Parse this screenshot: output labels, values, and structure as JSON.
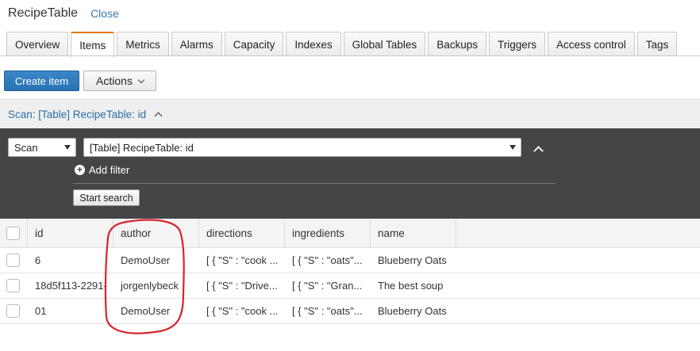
{
  "header": {
    "table_name": "RecipeTable",
    "close_label": "Close"
  },
  "tabs": [
    {
      "label": "Overview",
      "active": false
    },
    {
      "label": "Items",
      "active": true
    },
    {
      "label": "Metrics",
      "active": false
    },
    {
      "label": "Alarms",
      "active": false
    },
    {
      "label": "Capacity",
      "active": false
    },
    {
      "label": "Indexes",
      "active": false
    },
    {
      "label": "Global Tables",
      "active": false
    },
    {
      "label": "Backups",
      "active": false
    },
    {
      "label": "Triggers",
      "active": false
    },
    {
      "label": "Access control",
      "active": false
    },
    {
      "label": "Tags",
      "active": false
    }
  ],
  "toolbar": {
    "create_label": "Create item",
    "actions_label": "Actions"
  },
  "scan_panel": {
    "header_label": "Scan: [Table] RecipeTable: id",
    "mode_value": "Scan",
    "index_value": "[Table] RecipeTable: id",
    "add_filter_label": "Add filter",
    "start_search_label": "Start search"
  },
  "grid": {
    "columns": [
      "id",
      "author",
      "directions",
      "ingredients",
      "name"
    ],
    "rows": [
      {
        "id": "6",
        "author": "DemoUser",
        "directions": "[ { \"S\" : \"cook ...",
        "ingredients": "[ { \"S\" : \"oats\"...",
        "name": "Blueberry Oats"
      },
      {
        "id": "18d5f113-2291-",
        "author": "jorgenlybeck",
        "directions": "[ { \"S\" : \"Drive...",
        "ingredients": "[ { \"S\" : \"Gran...",
        "name": "The best soup"
      },
      {
        "id": "01",
        "author": "DemoUser",
        "directions": "[ { \"S\" : \"cook ...",
        "ingredients": "[ { \"S\" : \"oats\"...",
        "name": "Blueberry Oats"
      }
    ]
  },
  "colors": {
    "accent_tab": "#e47911",
    "primary_button": "#2873b4",
    "link": "#2e6fa8",
    "dark_panel": "#444546",
    "annotation": "#d9252a"
  }
}
